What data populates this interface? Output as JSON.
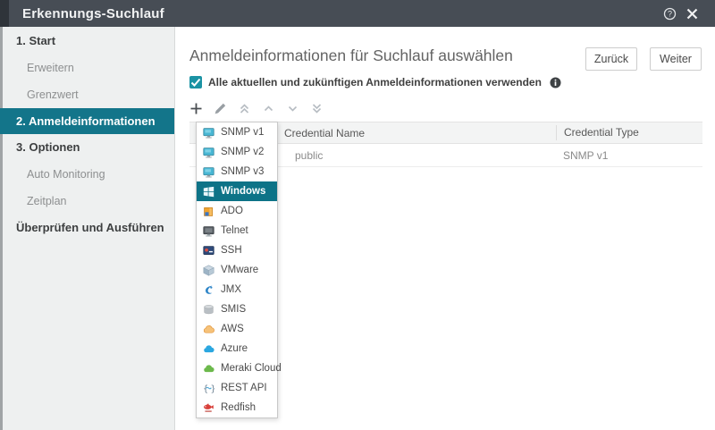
{
  "header": {
    "title": "Erkennungs-Suchlauf"
  },
  "sidebar": {
    "items": [
      {
        "label": "1. Start",
        "type": "step",
        "active": false
      },
      {
        "label": "Erweitern",
        "type": "sub",
        "active": false
      },
      {
        "label": "Grenzwert",
        "type": "sub",
        "active": false
      },
      {
        "label": "2. Anmeldeinformationen",
        "type": "step",
        "active": true
      },
      {
        "label": "3. Optionen",
        "type": "step",
        "active": false
      },
      {
        "label": "Auto Monitoring",
        "type": "sub",
        "active": false
      },
      {
        "label": "Zeitplan",
        "type": "sub",
        "active": false
      },
      {
        "label": "Überprüfen und Ausführen",
        "type": "step",
        "active": false
      }
    ]
  },
  "main": {
    "title": "Anmeldeinformationen für Suchlauf auswählen",
    "buttons": {
      "back": "Zurück",
      "next": "Weiter"
    },
    "use_all_checkbox": {
      "checked": true,
      "label": "Alle aktuellen und zukünftigen Anmeldeinformationen verwenden"
    },
    "toolbar": {
      "icons": [
        "add-icon",
        "edit-icon",
        "move-top-icon",
        "move-up-icon",
        "move-down-icon",
        "move-bottom-icon"
      ]
    },
    "table": {
      "columns": [
        "Credential Name",
        "Credential Type"
      ],
      "rows": [
        {
          "name": "public",
          "type": "SNMP v1"
        }
      ]
    }
  },
  "dropdown": {
    "items": [
      {
        "label": "SNMP v1",
        "icon": "snmp-monitor-icon",
        "selected": false
      },
      {
        "label": "SNMP v2",
        "icon": "snmp-monitor-icon",
        "selected": false
      },
      {
        "label": "SNMP v3",
        "icon": "snmp-monitor-icon",
        "selected": false
      },
      {
        "label": "Windows",
        "icon": "windows-icon",
        "selected": true
      },
      {
        "label": "ADO",
        "icon": "ado-database-icon",
        "selected": false
      },
      {
        "label": "Telnet",
        "icon": "telnet-terminal-icon",
        "selected": false
      },
      {
        "label": "SSH",
        "icon": "ssh-terminal-icon",
        "selected": false
      },
      {
        "label": "VMware",
        "icon": "vmware-cube-icon",
        "selected": false
      },
      {
        "label": "JMX",
        "icon": "jmx-icon",
        "selected": false
      },
      {
        "label": "SMIS",
        "icon": "smis-storage-icon",
        "selected": false
      },
      {
        "label": "AWS",
        "icon": "aws-cloud-icon",
        "selected": false
      },
      {
        "label": "Azure",
        "icon": "azure-cloud-icon",
        "selected": false
      },
      {
        "label": "Meraki Cloud",
        "icon": "meraki-cloud-icon",
        "selected": false
      },
      {
        "label": "REST API",
        "icon": "rest-api-icon",
        "selected": false
      },
      {
        "label": "Redfish",
        "icon": "redfish-icon",
        "selected": false
      }
    ]
  },
  "colors": {
    "accent_teal": "#13758a",
    "selected_item_teal": "#0d7387",
    "checkbox_teal": "#1b93a4",
    "header_bg": "#474d55",
    "sidebar_bg": "#eef0f0"
  }
}
